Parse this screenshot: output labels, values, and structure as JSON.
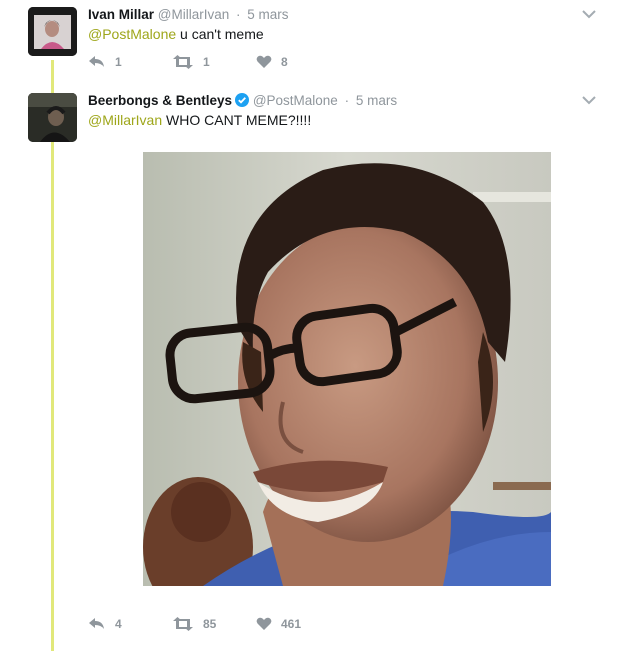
{
  "tweets": [
    {
      "display_name": "Ivan Millar",
      "handle": "@MillarIvan",
      "separator": "·",
      "time": "5 mars",
      "mention": "@PostMalone",
      "body": " u can't meme",
      "replies": "1",
      "retweets": "1",
      "likes": "8",
      "verified": false
    },
    {
      "display_name": "Beerbongs & Bentleys",
      "handle": "@PostMalone",
      "separator": "·",
      "time": "5 mars",
      "mention": "@MillarIvan",
      "body": " WHO CANT MEME?!!!!",
      "replies": "4",
      "retweets": "85",
      "likes": "461",
      "verified": true
    }
  ],
  "icons": {
    "reply": "reply-icon",
    "retweet": "retweet-icon",
    "like": "heart-icon",
    "caret": "chevron-down-icon",
    "verified": "verified-badge-icon"
  },
  "colors": {
    "accent": "#9ea61a",
    "thread_line": "#e1e87a",
    "muted": "#8f969c",
    "verified": "#1da1f2"
  }
}
